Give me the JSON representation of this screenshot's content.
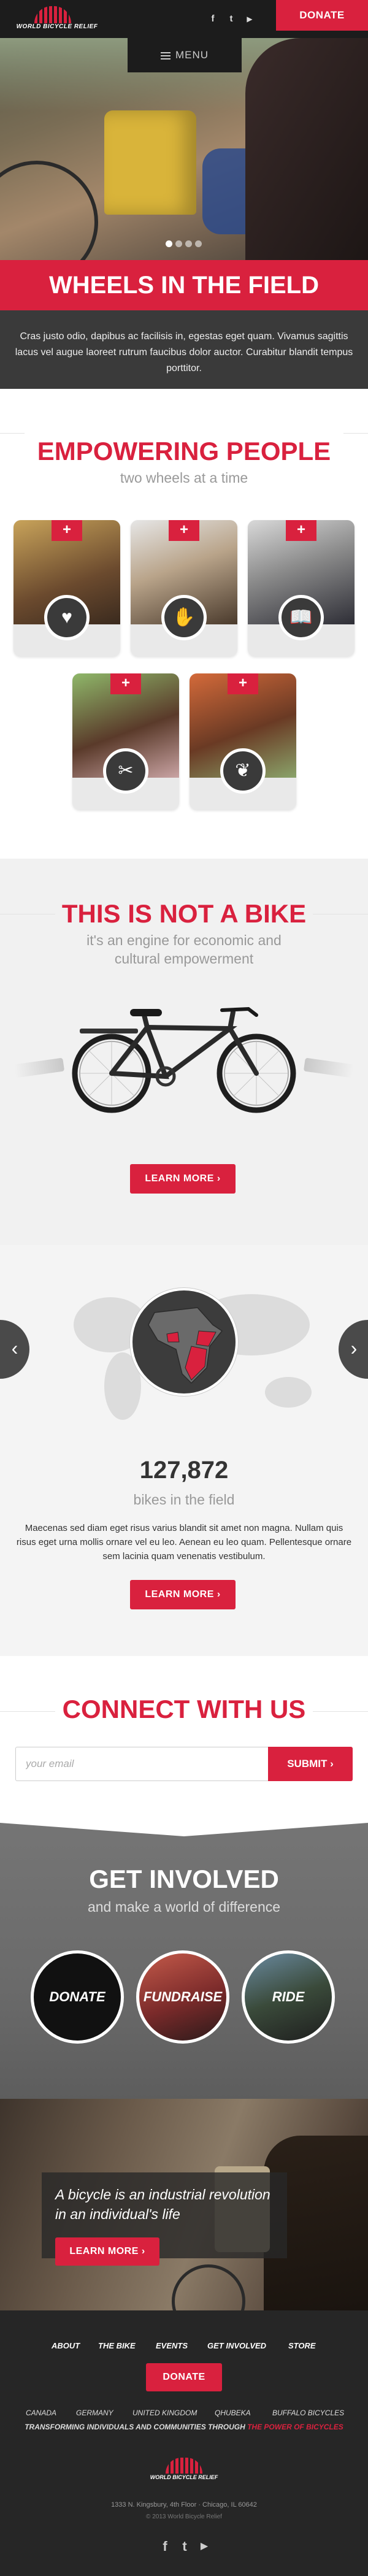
{
  "brand": {
    "logo_text": "WORLD BICYCLE RELIEF"
  },
  "header": {
    "social": [
      {
        "icon": "facebook-icon",
        "glyph": "f"
      },
      {
        "icon": "twitter-icon",
        "glyph": "t"
      },
      {
        "icon": "youtube-icon",
        "glyph": "▶"
      }
    ],
    "donate_label": "DONATE",
    "menu_label": "MENU"
  },
  "hero": {
    "slide_count": 4,
    "active_slide": 1,
    "title": "WHEELS IN THE FIELD",
    "body": "Cras justo odio, dapibus ac facilisis in, egestas eget quam. Vivamus sagittis lacus  vel augue laoreet rutrum faucibus dolor auctor. Curabitur blandit tempus porttitor."
  },
  "empowering": {
    "title": "EMPOWERING PEOPLE",
    "subtitle": "two wheels at a time",
    "cards": [
      {
        "name": "health",
        "plus": "+",
        "badge": "heart-icon",
        "glyph": "♥"
      },
      {
        "name": "economic",
        "plus": "+",
        "badge": "hands-icon",
        "glyph": "✋"
      },
      {
        "name": "education",
        "plus": "+",
        "badge": "book-icon",
        "glyph": "📖"
      },
      {
        "name": "tools",
        "plus": "+",
        "badge": "tools-icon",
        "glyph": "✂"
      },
      {
        "name": "agriculture",
        "plus": "+",
        "badge": "sprout-icon",
        "glyph": "❦"
      }
    ]
  },
  "bike": {
    "title": "THIS IS NOT A BIKE",
    "subtitle_line1": "it's an engine for economic and",
    "subtitle_line2": "cultural empowerment",
    "button_label": "LEARN MORE"
  },
  "map": {
    "count": "127,872",
    "count_label": "bikes in the field",
    "body": "Maecenas sed diam eget risus varius blandit sit amet non magna. Nullam quis risus eget urna mollis ornare vel eu leo. Aenean eu leo quam. Pellentesque ornare sem lacinia quam venenatis vestibulum.",
    "button_label": "LEARN MORE",
    "prev_glyph": "‹",
    "next_glyph": "›"
  },
  "connect": {
    "title": "CONNECT WITH US",
    "email_placeholder": "your email",
    "submit_label": "SUBMIT"
  },
  "involved": {
    "title": "GET INVOLVED",
    "subtitle": "and make a world of difference",
    "items": [
      {
        "label": "DONATE"
      },
      {
        "label": "FUNDRAISE"
      },
      {
        "label": "RIDE"
      }
    ]
  },
  "quote": {
    "text": "A bicycle is an industrial revolution in an individual's life",
    "button_label": "LEARN MORE"
  },
  "footer": {
    "nav": [
      "ABOUT",
      "THE BIKE",
      "EVENTS",
      "GET INVOLVED",
      "STORE"
    ],
    "donate_label": "DONATE",
    "countries": [
      "CANADA",
      "GERMANY",
      "UNITED KINGDOM",
      "QHUBEKA",
      "BUFFALO BICYCLES"
    ],
    "tagline_main": "TRANSFORMING INDIVIDUALS AND COMMUNITIES THROUGH ",
    "tagline_highlight": "THE POWER OF BICYCLES",
    "address": "1333 N. Kingsbury, 4th Floor · Chicago, IL 60642",
    "copyright": "© 2013 World Bicycle Relief",
    "social": [
      {
        "icon": "facebook-icon",
        "glyph": "f"
      },
      {
        "icon": "twitter-icon",
        "glyph": "t"
      },
      {
        "icon": "youtube-icon",
        "glyph": "▶"
      }
    ]
  },
  "colors": {
    "accent": "#d9213e",
    "dark": "#262626",
    "gray": "#3a3a3a"
  }
}
